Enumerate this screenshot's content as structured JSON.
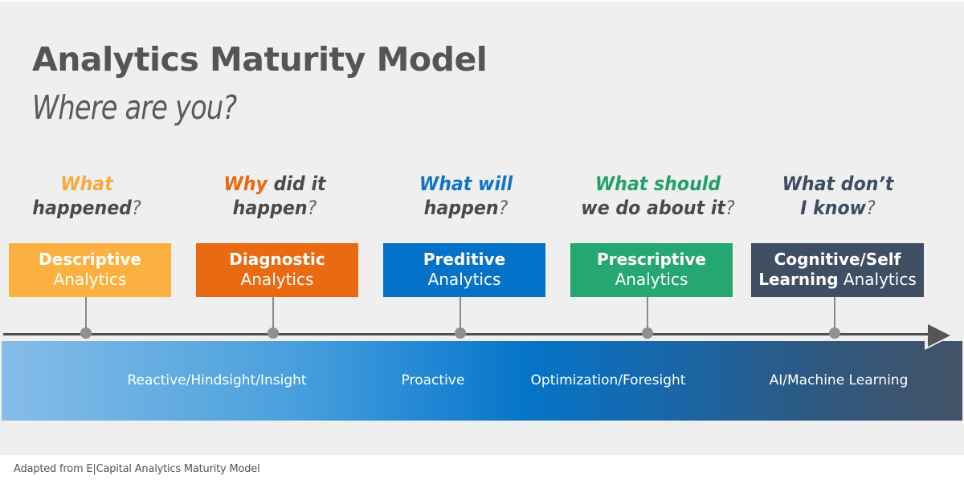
{
  "header": {
    "title": "Analytics Maturity Model",
    "subtitle": "Where are you?"
  },
  "stages": [
    {
      "question_highlight": "What",
      "question_rest": " happened",
      "question_mark": "?",
      "question_lines": [
        "What",
        "happened?"
      ],
      "box_bold": "Descriptive",
      "box_normal": "Analytics",
      "color": "#fbb040",
      "highlight_color": "#f9a93c"
    },
    {
      "question_highlight": "Why",
      "question_rest": " did it happen",
      "question_mark": "?",
      "box_bold": "Diagnostic",
      "box_normal": "Analytics",
      "color": "#e96a12",
      "highlight_color": "#e9670f"
    },
    {
      "question_highlight": "What will",
      "question_rest": " happen",
      "question_mark": "?",
      "box_bold": "Preditive",
      "box_normal": "Analytics",
      "color": "#0472c8",
      "highlight_color": "#1373c6"
    },
    {
      "question_highlight": "What should",
      "question_rest": " we do about it",
      "question_mark": "?",
      "box_bold": "Prescriptive",
      "box_normal": "Analytics",
      "color": "#25a772",
      "highlight_color": "#229f6c"
    },
    {
      "question_highlight": "What don’t",
      "question_rest": " I know",
      "question_mark": "?",
      "box_bold": "Cognitive/Self Learning",
      "box_normal": "Analytics",
      "color": "#3f4e63",
      "highlight_color": "#3c4d63"
    }
  ],
  "band_labels": [
    "Reactive/Hindsight/Insight",
    "Proactive",
    "Optimization/Foresight",
    "AI/Machine Learning"
  ],
  "footer": "Adapted from E|Capital Analytics Maturity Model"
}
